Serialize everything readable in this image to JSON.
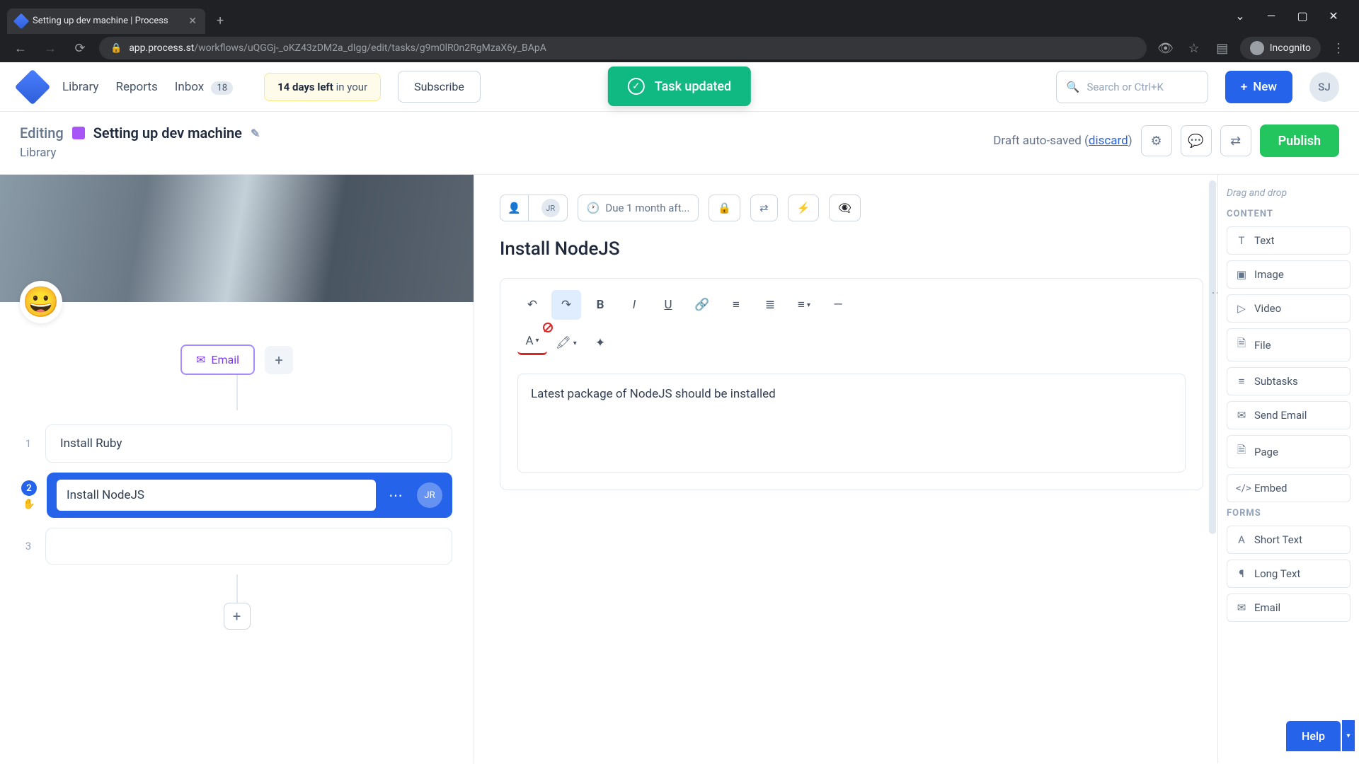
{
  "browser": {
    "tab_title": "Setting up dev machine | Process",
    "url_host": "app.process.st",
    "url_path": "/workflows/uQGGj-_oKZ43zDM2a_dIgg/edit/tasks/g9m0lR0n2RgMzaX6y_BApA",
    "incognito": "Incognito"
  },
  "app_nav": {
    "library": "Library",
    "reports": "Reports",
    "inbox": "Inbox",
    "inbox_count": "18",
    "trial_prefix": "14 days left",
    "trial_suffix": " in your",
    "subscribe": "Subscribe",
    "search_placeholder": "Search or Ctrl+K",
    "new": "New",
    "avatar": "SJ"
  },
  "toast": {
    "text": "Task updated"
  },
  "edit_header": {
    "editing_label": "Editing",
    "workflow_title": "Setting up dev machine",
    "breadcrumb": "Library",
    "autosave_prefix": "Draft auto-saved (",
    "discard": "discard",
    "autosave_suffix": ")",
    "publish": "Publish"
  },
  "left": {
    "emoji": "😀",
    "email_btn": "Email",
    "tasks": [
      {
        "num": "1",
        "title": "Install Ruby"
      },
      {
        "num": "2",
        "title": "Install NodeJS",
        "assignee": "JR"
      },
      {
        "num": "3",
        "title": ""
      }
    ]
  },
  "task_detail": {
    "assignee": "JR",
    "due_text": "Due 1 month aft...",
    "title": "Install NodeJS",
    "body": "Latest package of NodeJS should be installed"
  },
  "side_panel": {
    "hint": "Drag and drop",
    "section_content": "CONTENT",
    "items_content": [
      "Text",
      "Image",
      "Video",
      "File",
      "Subtasks",
      "Send Email",
      "Page",
      "Embed"
    ],
    "section_forms": "FORMS",
    "items_forms": [
      "Short Text",
      "Long Text",
      "Email"
    ]
  },
  "help": "Help"
}
